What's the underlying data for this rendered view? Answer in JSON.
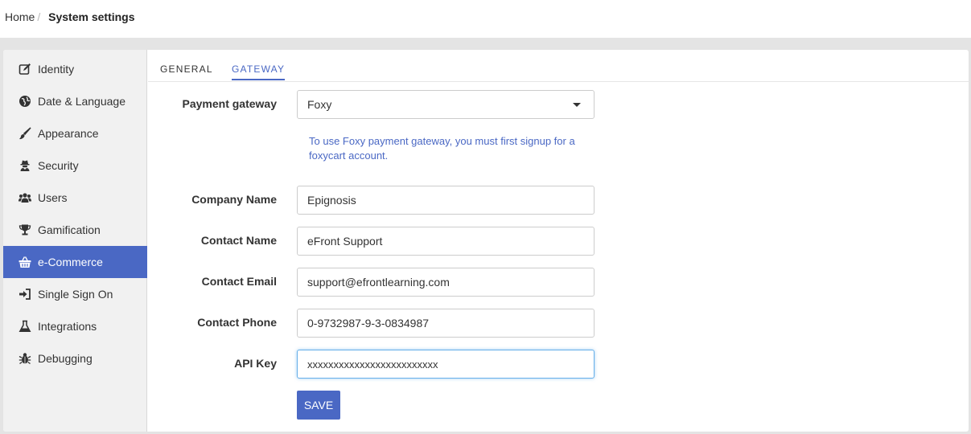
{
  "breadcrumb": {
    "home": "Home",
    "separator": "/",
    "current": "System settings"
  },
  "sidebar": {
    "items": [
      {
        "label": "Identity",
        "icon": "edit-icon"
      },
      {
        "label": "Date & Language",
        "icon": "globe-icon"
      },
      {
        "label": "Appearance",
        "icon": "brush-icon"
      },
      {
        "label": "Security",
        "icon": "user-secret-icon"
      },
      {
        "label": "Users",
        "icon": "users-icon"
      },
      {
        "label": "Gamification",
        "icon": "trophy-icon"
      },
      {
        "label": "e-Commerce",
        "icon": "basket-icon",
        "active": true
      },
      {
        "label": "Single Sign On",
        "icon": "sign-in-icon"
      },
      {
        "label": "Integrations",
        "icon": "flask-icon"
      },
      {
        "label": "Debugging",
        "icon": "bug-icon"
      }
    ]
  },
  "tabs": [
    {
      "label": "GENERAL",
      "active": false
    },
    {
      "label": "GATEWAY",
      "active": true
    }
  ],
  "form": {
    "payment_gateway": {
      "label": "Payment gateway",
      "value": "Foxy",
      "help": "To use Foxy payment gateway, you must first signup for a foxycart account."
    },
    "company_name": {
      "label": "Company Name",
      "value": "Epignosis"
    },
    "contact_name": {
      "label": "Contact Name",
      "value": "eFront Support"
    },
    "contact_email": {
      "label": "Contact Email",
      "value": "support@efrontlearning.com"
    },
    "contact_phone": {
      "label": "Contact Phone",
      "value": "0-9732987-9-3-0834987"
    },
    "api_key": {
      "label": "API Key",
      "value": "xxxxxxxxxxxxxxxxxxxxxxxxx"
    },
    "save_label": "SAVE"
  },
  "colors": {
    "accent": "#4a68c4",
    "sidebar_bg": "#f1f1f1",
    "page_bg": "#e4e4e4"
  }
}
